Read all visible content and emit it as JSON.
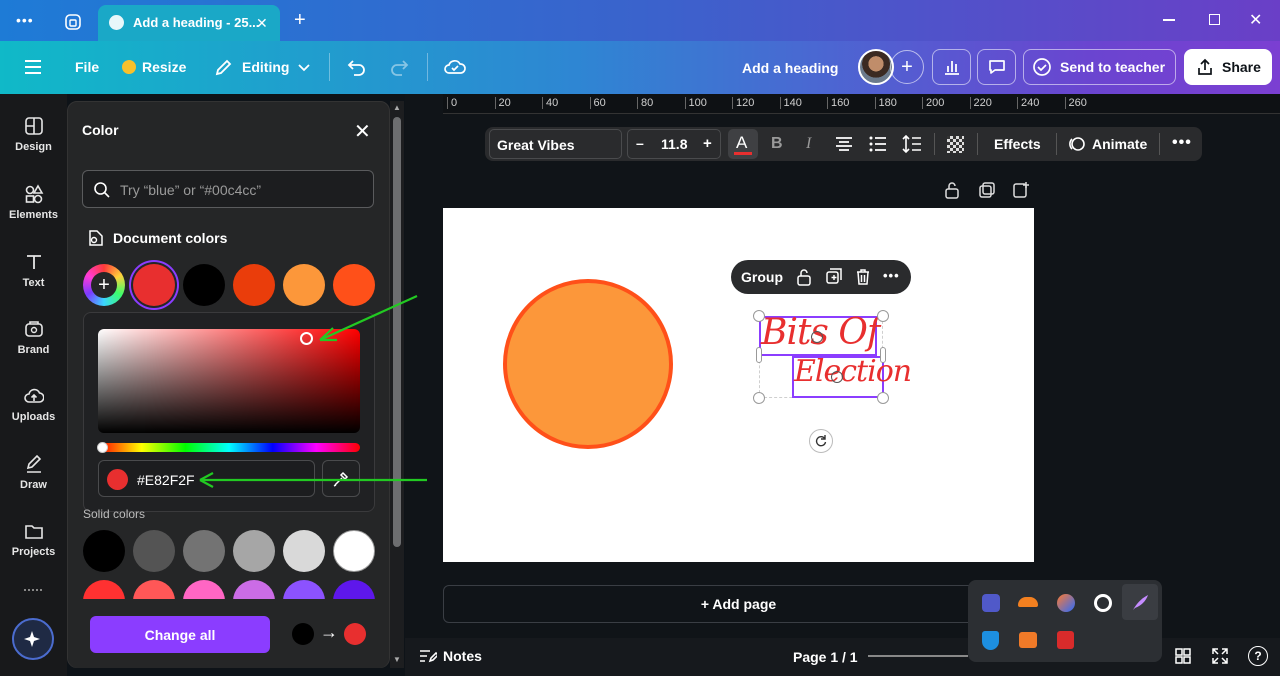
{
  "browser": {
    "tab_title": "Add a heading - 25...",
    "new_tab": "+",
    "menu_dots": "•••"
  },
  "header": {
    "file": "File",
    "resize": "Resize",
    "editing": "Editing",
    "doc_title": "Add a heading",
    "send_to_teacher": "Send to teacher",
    "share": "Share",
    "add_collaborator": "+"
  },
  "rail": {
    "items": [
      {
        "label": "Design",
        "icon": "design-icon"
      },
      {
        "label": "Elements",
        "icon": "elements-icon"
      },
      {
        "label": "Text",
        "icon": "text-icon"
      },
      {
        "label": "Brand",
        "icon": "brand-icon"
      },
      {
        "label": "Uploads",
        "icon": "uploads-icon"
      },
      {
        "label": "Draw",
        "icon": "draw-icon"
      },
      {
        "label": "Projects",
        "icon": "projects-icon"
      }
    ]
  },
  "color_panel": {
    "title": "Color",
    "search_placeholder": "Try “blue” or “#00c4cc”",
    "document_colors_label": "Document colors",
    "document_colors": [
      "#E82F2F",
      "#000000",
      "#EA3D0B",
      "#FC973A",
      "#FF5019"
    ],
    "hex_value": "#E82F2F",
    "hue_color": "#ff0000",
    "solid_colors_label": "Solid colors",
    "solid_colors": [
      "#000000",
      "#545454",
      "#737373",
      "#a6a6a6",
      "#d9d9d9",
      "#ffffff"
    ],
    "solid_colors_row2": [
      "#ff3131",
      "#ff5757",
      "#ff66c4",
      "#cb6ce6",
      "#8c52ff",
      "#5e17eb"
    ],
    "change_all": "Change all",
    "from_color": "#000000",
    "to_color": "#E82F2F"
  },
  "ruler": {
    "ticks": [
      "0",
      "20",
      "40",
      "60",
      "80",
      "100",
      "120",
      "140",
      "160",
      "180",
      "200",
      "220",
      "240",
      "260"
    ]
  },
  "text_toolbar": {
    "font": "Great Vibes",
    "minus": "–",
    "size": "11.8",
    "plus": "+",
    "text_color_letter": "A",
    "bold": "B",
    "italic": "I",
    "effects": "Effects",
    "animate": "Animate"
  },
  "canvas": {
    "group_label": "Group",
    "text_line1": "Bits Of",
    "text_line2": "Election",
    "circle_fill": "#FC973A",
    "circle_stroke": "#FF5019",
    "text_color": "#E82F2F",
    "add_page": "+ Add page"
  },
  "footer": {
    "notes": "Notes",
    "page_indicator": "Page 1 / 1"
  },
  "annotations": {
    "arrow_color": "#22c922"
  }
}
